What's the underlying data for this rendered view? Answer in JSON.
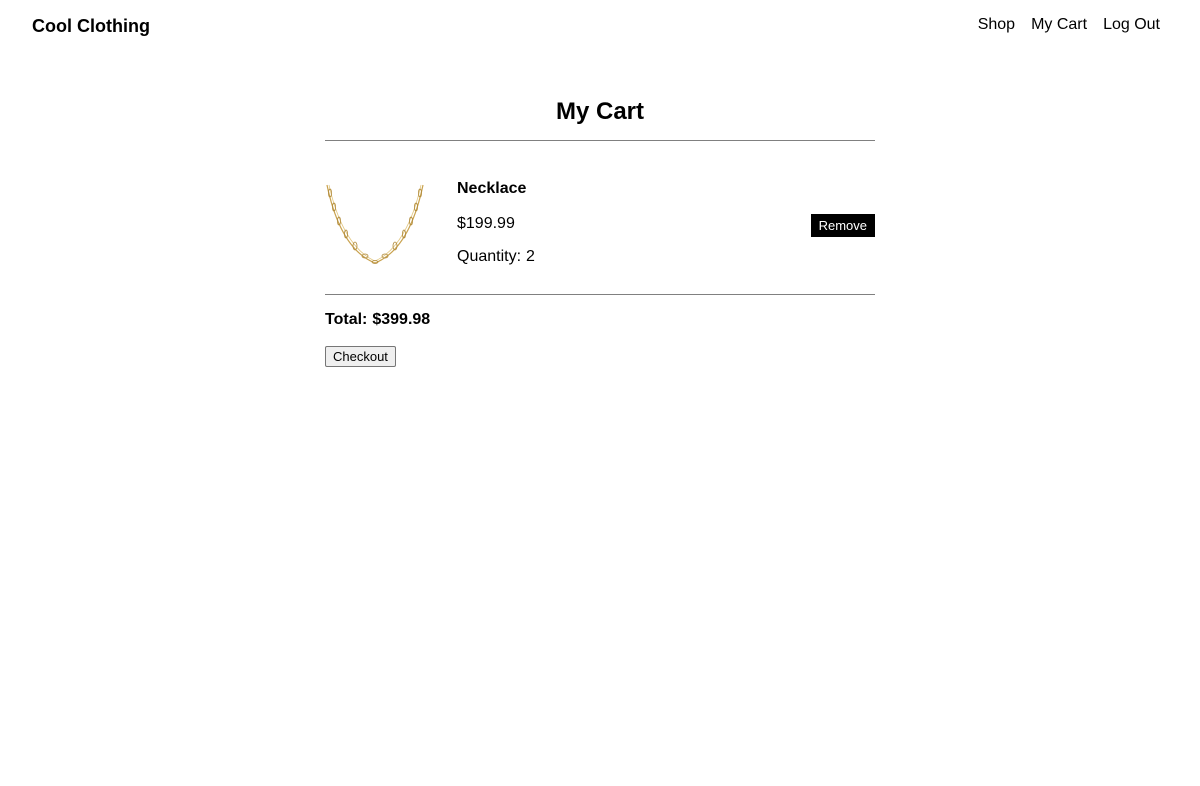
{
  "header": {
    "brand": "Cool Clothing",
    "nav": [
      "Shop",
      "My Cart",
      "Log Out"
    ]
  },
  "cart": {
    "title": "My Cart",
    "items": [
      {
        "name": "Necklace",
        "price": "$199.99",
        "quantity_label": "Quantity:",
        "quantity": "2",
        "remove_label": "Remove",
        "image_icon": "gold-chain-necklace-icon"
      }
    ],
    "total_label": "Total:",
    "total_value": "$399.98",
    "checkout_label": "Checkout"
  },
  "colors": {
    "text": "#000000",
    "divider": "#808080",
    "remove_button_bg": "#000000",
    "remove_button_text": "#ffffff",
    "chain_gold": "#c9a24e"
  }
}
